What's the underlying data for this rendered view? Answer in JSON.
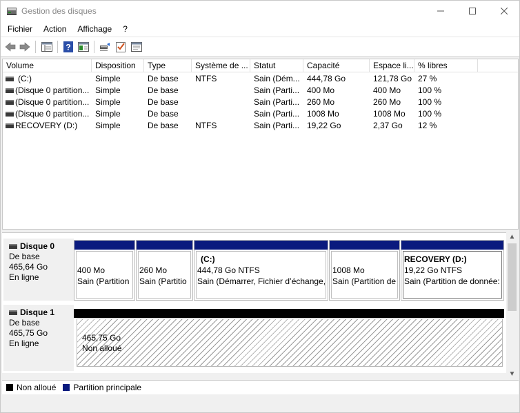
{
  "window": {
    "title": "Gestion des disques"
  },
  "menu": [
    "Fichier",
    "Action",
    "Affichage",
    "?"
  ],
  "list": {
    "columns": [
      "Volume",
      "Disposition",
      "Type",
      "Système de ...",
      "Statut",
      "Capacité",
      "Espace li...",
      "% libres"
    ],
    "rows": [
      [
        "(C:)",
        "Simple",
        "De base",
        "NTFS",
        "Sain (Dém...",
        "444,78 Go",
        "121,78 Go",
        "27 %"
      ],
      [
        "(Disque 0 partition...",
        "Simple",
        "De base",
        "",
        "Sain (Parti...",
        "400 Mo",
        "400 Mo",
        "100 %"
      ],
      [
        "(Disque 0 partition...",
        "Simple",
        "De base",
        "",
        "Sain (Parti...",
        "260 Mo",
        "260 Mo",
        "100 %"
      ],
      [
        "(Disque 0 partition...",
        "Simple",
        "De base",
        "",
        "Sain (Parti...",
        "1008 Mo",
        "1008 Mo",
        "100 %"
      ],
      [
        "RECOVERY (D:)",
        "Simple",
        "De base",
        "NTFS",
        "Sain (Parti...",
        "19,22 Go",
        "2,37 Go",
        "12 %"
      ]
    ]
  },
  "disks": [
    {
      "name": "Disque 0",
      "type": "De base",
      "size": "465,64 Go",
      "status": "En ligne",
      "partitions": [
        {
          "title": "",
          "size": "400 Mo",
          "status": "Sain (Partition"
        },
        {
          "title": "",
          "size": "260 Mo",
          "status": "Sain (Partitio"
        },
        {
          "title": "(C:)",
          "size": "444,78 Go NTFS",
          "status": "Sain (Démarrer, Fichier d’échange,"
        },
        {
          "title": "",
          "size": "1008 Mo",
          "status": "Sain (Partition de"
        },
        {
          "title": "RECOVERY  (D:)",
          "size": "19,22 Go NTFS",
          "status": "Sain (Partition de donnée:"
        }
      ]
    },
    {
      "name": "Disque 1",
      "type": "De base",
      "size": "465,75 Go",
      "status": "En ligne",
      "unallocated": {
        "size": "465,75 Go",
        "label": "Non alloué"
      }
    }
  ],
  "legend": [
    {
      "label": "Non alloué",
      "color": "#000000"
    },
    {
      "label": "Partition principale",
      "color": "#0a1a7e"
    }
  ],
  "icons": {
    "app": "disk-management-icon",
    "back": "back-arrow-icon",
    "forward": "forward-arrow-icon",
    "properties": "disk-list-icon",
    "help": "help-icon",
    "view": "console-tree-icon",
    "connect": "rescan-disks-icon",
    "check": "checklist-icon",
    "settings": "properties-panel-icon"
  }
}
